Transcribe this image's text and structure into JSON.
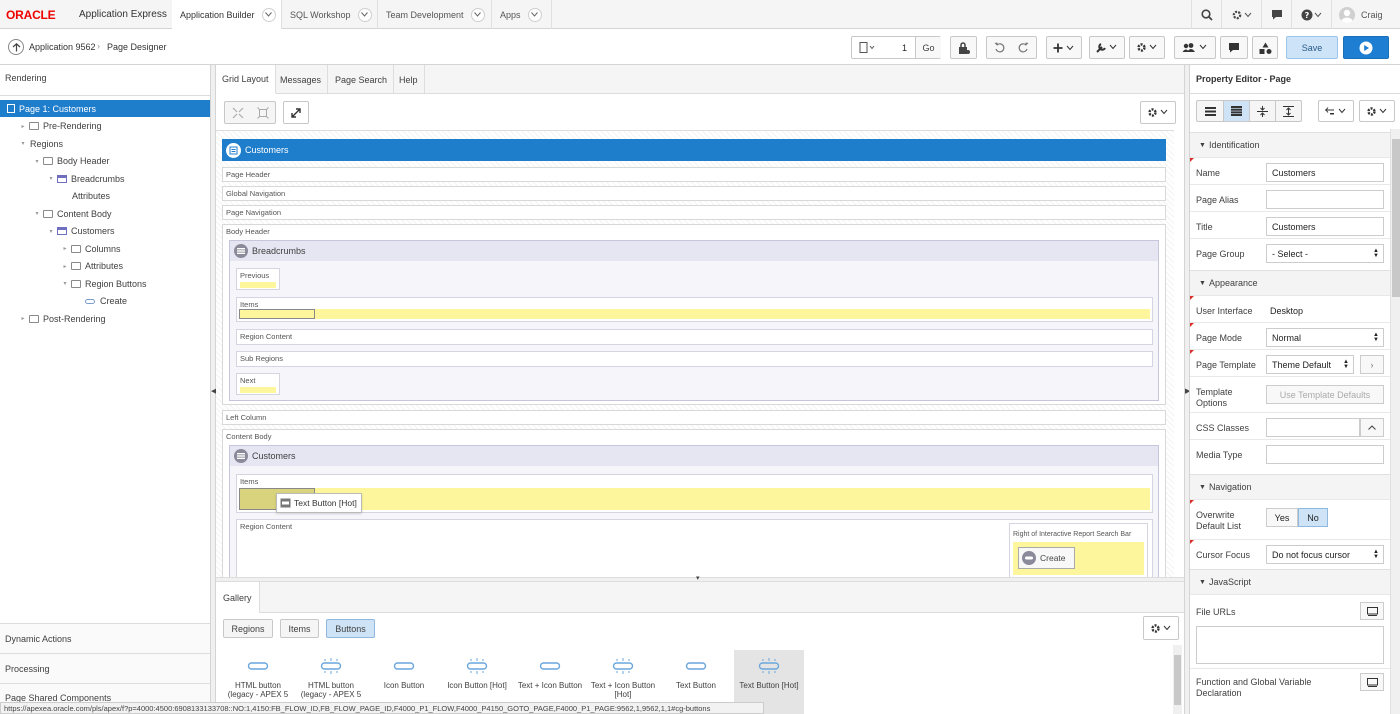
{
  "topbar": {
    "brand": "ORACLE",
    "product": "Application Express",
    "tabs": [
      "Application Builder",
      "SQL Workshop",
      "Team Development",
      "Apps"
    ],
    "user": "Craig"
  },
  "toolbar": {
    "app_label": "Application 9562",
    "page_designer": "Page Designer",
    "page_number": "1",
    "go_label": "Go",
    "save_label": "Save"
  },
  "left": {
    "header": "Rendering",
    "tree": [
      {
        "label": "Page 1: Customers",
        "level": 0,
        "icon": "page",
        "selected": true
      },
      {
        "label": "Pre-Rendering",
        "level": 1,
        "icon": "folder",
        "twisty": "▸"
      },
      {
        "label": "Regions",
        "level": 1,
        "icon": "none",
        "twisty": "▾"
      },
      {
        "label": "Body Header",
        "level": 2,
        "icon": "folder",
        "twisty": "▾"
      },
      {
        "label": "Breadcrumbs",
        "level": 3,
        "icon": "region",
        "twisty": "▾"
      },
      {
        "label": "Attributes",
        "level": 4,
        "icon": "none",
        "twisty": ""
      },
      {
        "label": "Content Body",
        "level": 2,
        "icon": "folder",
        "twisty": "▾"
      },
      {
        "label": "Customers",
        "level": 3,
        "icon": "region",
        "twisty": "▾"
      },
      {
        "label": "Columns",
        "level": 4,
        "icon": "folder",
        "twisty": "▸"
      },
      {
        "label": "Attributes",
        "level": 4,
        "icon": "folder",
        "twisty": "▸"
      },
      {
        "label": "Region Buttons",
        "level": 4,
        "icon": "folder",
        "twisty": "▾"
      },
      {
        "label": "Create",
        "level": 5,
        "icon": "button",
        "twisty": ""
      },
      {
        "label": "Post-Rendering",
        "level": 1,
        "icon": "folder",
        "twisty": "▸"
      }
    ],
    "sections": [
      "Dynamic Actions",
      "Processing",
      "Page Shared Components"
    ]
  },
  "center": {
    "tabs": [
      "Grid Layout",
      "Messages",
      "Page Search",
      "Help"
    ],
    "page_region_title": "Customers",
    "slots": {
      "page_header": "Page Header",
      "global_navigation": "Global Navigation",
      "page_navigation": "Page Navigation",
      "body_header": "Body Header",
      "left_column": "Left Column",
      "content_body": "Content Body"
    },
    "breadcrumbs": {
      "title": "Breadcrumbs",
      "previous": "Previous",
      "items": "Items",
      "region_content": "Region Content",
      "sub_regions": "Sub Regions",
      "next": "Next"
    },
    "customers": {
      "title": "Customers",
      "items": "Items",
      "region_content": "Region Content",
      "search_bar": "Right of Interactive Report Search Bar",
      "create_button": "Create",
      "drag_tooltip": "Text Button [Hot]"
    },
    "gallery": {
      "tab": "Gallery",
      "filters": [
        "Regions",
        "Items",
        "Buttons"
      ],
      "selected_filter": "Buttons",
      "items": [
        {
          "label": "HTML button (legacy - APEX 5",
          "hot": false
        },
        {
          "label": "HTML button (legacy - APEX 5",
          "hot": true
        },
        {
          "label": "Icon Button",
          "hot": false
        },
        {
          "label": "Icon Button [Hot]",
          "hot": true
        },
        {
          "label": "Text + Icon Button",
          "hot": false
        },
        {
          "label": "Text + Icon Button [Hot]",
          "hot": true
        },
        {
          "label": "Text Button",
          "hot": false
        },
        {
          "label": "Text Button [Hot]",
          "hot": true,
          "selected": true
        }
      ]
    }
  },
  "right": {
    "header": "Property Editor - Page",
    "sections": {
      "identification": "Identification",
      "appearance": "Appearance",
      "navigation": "Navigation",
      "javascript": "JavaScript"
    },
    "props": {
      "name_label": "Name",
      "name_value": "Customers",
      "alias_label": "Page Alias",
      "alias_value": "",
      "title_label": "Title",
      "title_value": "Customers",
      "group_label": "Page Group",
      "group_value": "- Select -",
      "ui_label": "User Interface",
      "ui_value": "Desktop",
      "mode_label": "Page Mode",
      "mode_value": "Normal",
      "template_label": "Page Template",
      "template_value": "Theme Default",
      "tpl_opts_label": "Template Options",
      "tpl_opts_button": "Use Template Defaults",
      "css_label": "CSS Classes",
      "css_value": "",
      "media_label": "Media Type",
      "media_value": "",
      "overwrite_label": "Overwrite Default List",
      "overwrite_yes": "Yes",
      "overwrite_no": "No",
      "cursor_label": "Cursor Focus",
      "cursor_value": "Do not focus cursor",
      "file_urls_label": "File URLs",
      "func_label": "Function and Global Variable Declaration"
    }
  },
  "status_url": "https://apexea.oracle.com/pls/apex/f?p=4000:4500:6908133133708::NO:1,4150:FB_FLOW_ID,FB_FLOW_PAGE_ID,F4000_P1_FLOW,F4000_P4150_GOTO_PAGE,F4000_P1_PAGE:9562,1,9562,1,1#cg-buttons",
  "colors": {
    "accent": "#1f7ecc",
    "save": "#cde3f7",
    "run": "#1e7ed2",
    "region_header": "#e6e6f3",
    "highlight": "#fdf69c"
  }
}
